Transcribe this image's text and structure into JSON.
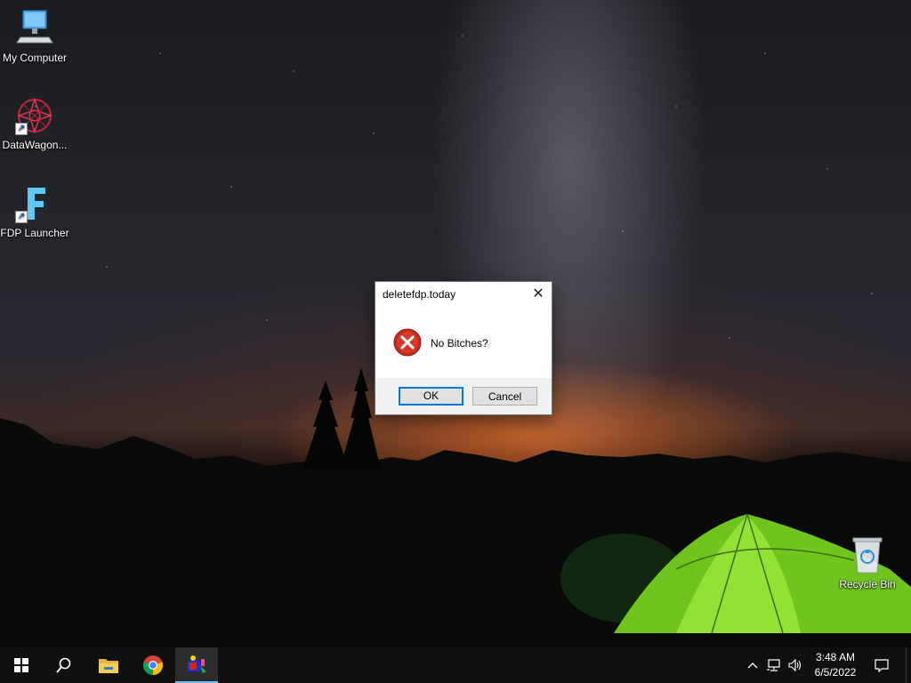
{
  "desktop": {
    "icons": [
      {
        "label": "My Computer",
        "icon": "computer-icon"
      },
      {
        "label": "DataWagon...",
        "icon": "datawagon-icon"
      },
      {
        "label": "FDP Launcher",
        "icon": "fdp-launcher-icon"
      },
      {
        "label": "Recycle Bin",
        "icon": "recycle-bin-icon"
      }
    ]
  },
  "dialog": {
    "title": "deletefdp.today",
    "message": "No Bitches?",
    "icon": "error-icon",
    "ok_label": "OK",
    "cancel_label": "Cancel",
    "close_glyph": "✕"
  },
  "taskbar": {
    "items": [
      {
        "icon": "windows-start-icon"
      },
      {
        "icon": "search-icon"
      },
      {
        "icon": "file-explorer-icon"
      },
      {
        "icon": "chrome-icon"
      },
      {
        "icon": "app-icon",
        "active": true
      }
    ],
    "tray": {
      "icons": [
        "chevron-up-icon",
        "network-icon",
        "volume-icon"
      ],
      "time": "3:48 AM",
      "date": "6/5/2022",
      "notification_icon": "notification-icon"
    }
  },
  "colors": {
    "accent": "#0078d7",
    "error_red": "#c42b1c",
    "taskbar_bg": "#101010"
  }
}
